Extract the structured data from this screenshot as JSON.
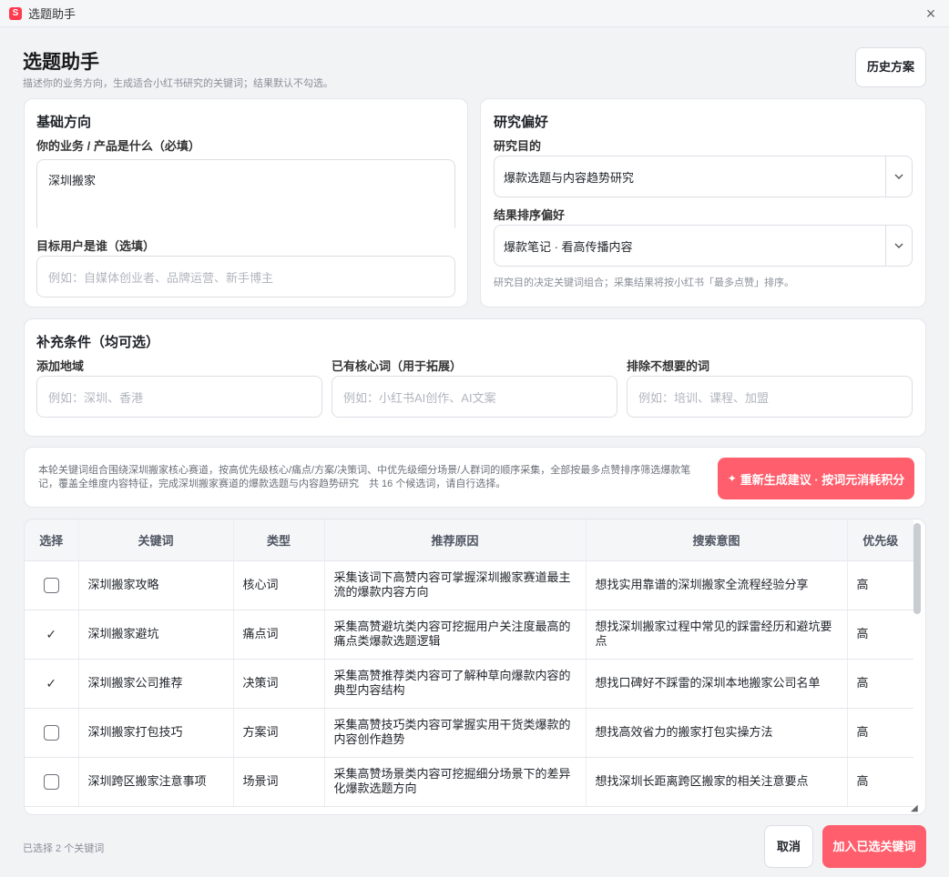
{
  "window": {
    "title": "选题助手",
    "app_icon_text": "S"
  },
  "header": {
    "title": "选题助手",
    "subtitle": "描述你的业务方向，生成适合小红书研究的关键词；结果默认不勾选。",
    "history_button": "历史方案"
  },
  "basic": {
    "title": "基础方向",
    "business_label": "你的业务 / 产品是什么（必填）",
    "business_value": "深圳搬家",
    "target_label": "目标用户是谁（选填）",
    "target_placeholder": "例如：自媒体创业者、品牌运营、新手博主"
  },
  "research": {
    "title": "研究偏好",
    "purpose_label": "研究目的",
    "purpose_value": "爆款选题与内容趋势研究",
    "sort_label": "结果排序偏好",
    "sort_value": "爆款笔记 · 看高传播内容",
    "hint": "研究目的决定关键词组合；采集结果将按小红书「最多点赞」排序。"
  },
  "extra": {
    "title": "补充条件（均可选）",
    "region_label": "添加地域",
    "region_placeholder": "例如：深圳、香港",
    "core_label": "已有核心词（用于拓展）",
    "core_placeholder": "例如：小红书AI创作、AI文案",
    "exclude_label": "排除不想要的词",
    "exclude_placeholder": "例如：培训、课程、加盟"
  },
  "info": {
    "text": "本轮关键词组合围绕深圳搬家核心赛道，按高优先级核心/痛点/方案/决策词、中优先级细分场景/人群词的顺序采集，全部按最多点赞排序筛选爆款笔记，覆盖全维度内容特征，完成深圳搬家赛道的爆款选题与内容趋势研究　共 16 个候选词，请自行选择。",
    "regen_button": "重新生成建议 · 按词元消耗积分"
  },
  "table": {
    "headers": [
      "选择",
      "关键词",
      "类型",
      "推荐原因",
      "搜索意图",
      "优先级"
    ],
    "rows": [
      {
        "selected": false,
        "keyword": "深圳搬家攻略",
        "type": "核心词",
        "reason": "采集该词下高赞内容可掌握深圳搬家赛道最主流的爆款内容方向",
        "intent": "想找实用靠谱的深圳搬家全流程经验分享",
        "priority": "高"
      },
      {
        "selected": true,
        "keyword": "深圳搬家避坑",
        "type": "痛点词",
        "reason": "采集高赞避坑类内容可挖掘用户关注度最高的痛点类爆款选题逻辑",
        "intent": "想找深圳搬家过程中常见的踩雷经历和避坑要点",
        "priority": "高"
      },
      {
        "selected": true,
        "keyword": "深圳搬家公司推荐",
        "type": "决策词",
        "reason": "采集高赞推荐类内容可了解种草向爆款内容的典型内容结构",
        "intent": "想找口碑好不踩雷的深圳本地搬家公司名单",
        "priority": "高"
      },
      {
        "selected": false,
        "keyword": "深圳搬家打包技巧",
        "type": "方案词",
        "reason": "采集高赞技巧类内容可掌握实用干货类爆款的内容创作趋势",
        "intent": "想找高效省力的搬家打包实操方法",
        "priority": "高"
      },
      {
        "selected": false,
        "keyword": "深圳跨区搬家注意事项",
        "type": "场景词",
        "reason": "采集高赞场景类内容可挖掘细分场景下的差异化爆款选题方向",
        "intent": "想找深圳长距离跨区搬家的相关注意要点",
        "priority": "高"
      }
    ]
  },
  "footer": {
    "selected_count": "已选择 2 个关键词",
    "cancel_button": "取消",
    "add_button": "加入已选关键词"
  }
}
